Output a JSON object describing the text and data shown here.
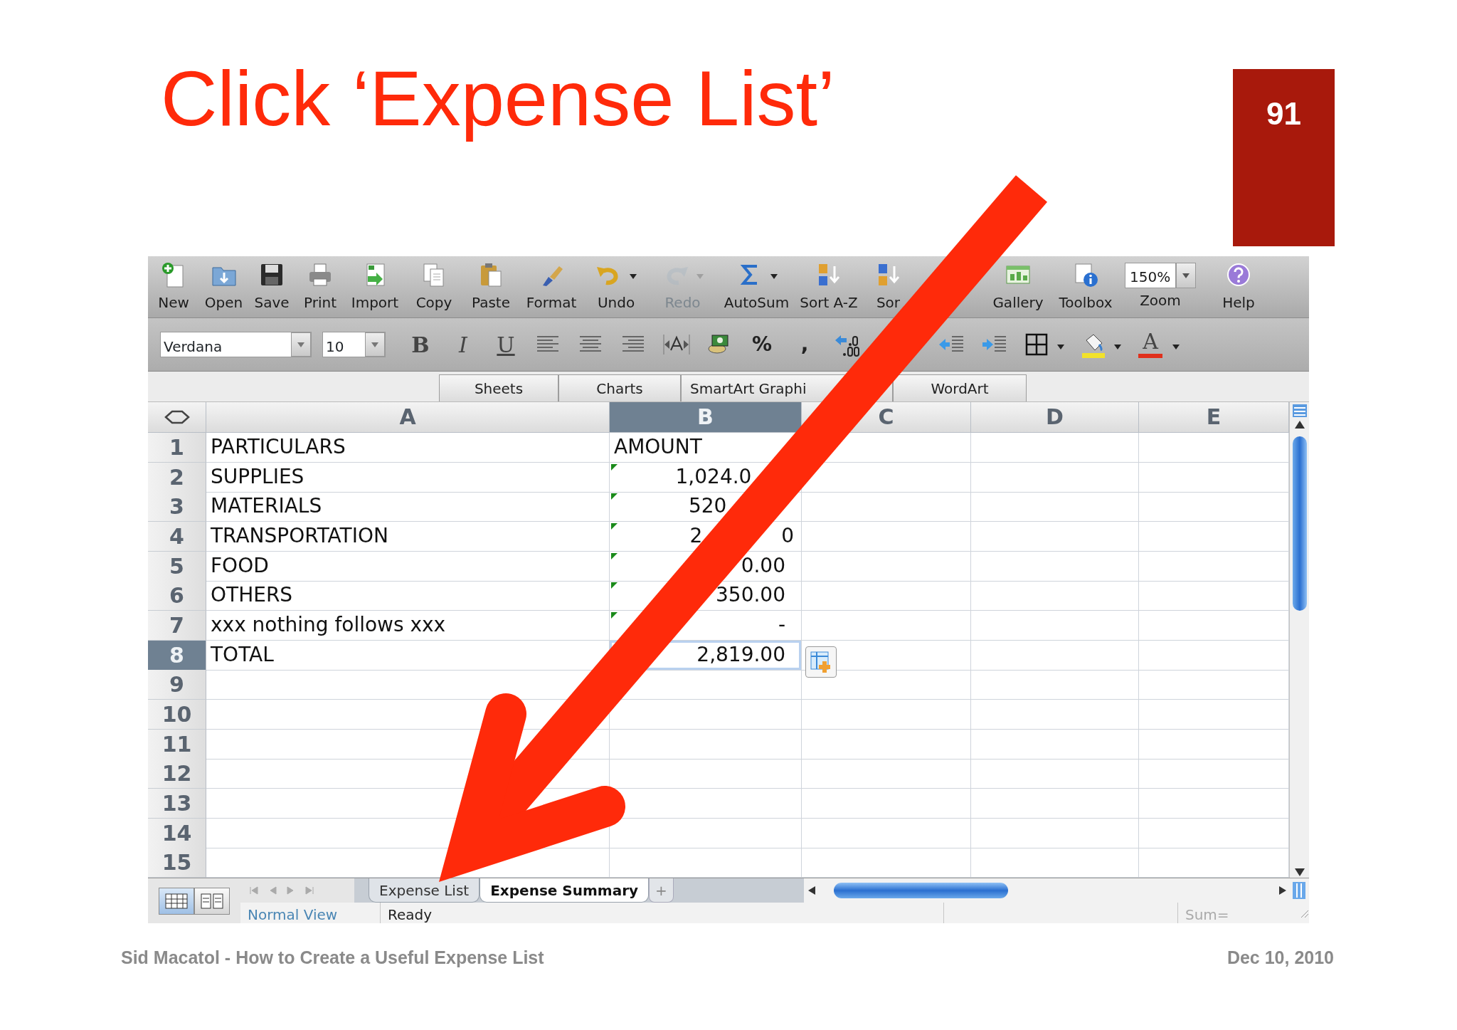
{
  "slide": {
    "title": "Click ‘Expense List’",
    "page_number": "91"
  },
  "standard_toolbar": [
    {
      "kind": "button",
      "label": "New",
      "disabled": false,
      "menu": false
    },
    {
      "kind": "button",
      "label": "Open",
      "disabled": false,
      "menu": false
    },
    {
      "kind": "button",
      "label": "Save",
      "disabled": false,
      "menu": false
    },
    {
      "kind": "button",
      "label": "Print",
      "disabled": false,
      "menu": false
    },
    {
      "kind": "button",
      "label": "Import",
      "disabled": false,
      "menu": false
    },
    {
      "kind": "button",
      "label": "Copy",
      "disabled": false,
      "menu": false
    },
    {
      "kind": "button",
      "label": "Paste",
      "disabled": false,
      "menu": false
    },
    {
      "kind": "button",
      "label": "Format",
      "disabled": false,
      "menu": false
    },
    {
      "kind": "button",
      "label": "Undo",
      "disabled": false,
      "menu": true
    },
    {
      "kind": "button",
      "label": "Redo",
      "disabled": true,
      "menu": true
    },
    {
      "kind": "button",
      "label": "AutoSum",
      "disabled": false,
      "menu": true
    },
    {
      "kind": "button",
      "label": "Sort A-Z",
      "disabled": false,
      "menu": false
    },
    {
      "kind": "button",
      "label": "Sor",
      "disabled": false,
      "menu": false
    },
    {
      "kind": "button",
      "label": "Gallery",
      "disabled": false,
      "menu": false
    },
    {
      "kind": "button",
      "label": "Toolbox",
      "disabled": false,
      "menu": false
    },
    {
      "kind": "combo",
      "label": "Zoom",
      "value": "150%",
      "disabled": false,
      "menu": true
    },
    {
      "kind": "button",
      "label": "Help",
      "disabled": false,
      "menu": false
    }
  ],
  "formatting_toolbar": {
    "font": "Verdana",
    "size": "10",
    "items": [
      {
        "kind": "text",
        "label": "B",
        "menu": false
      },
      {
        "kind": "text",
        "label": "I",
        "menu": false
      },
      {
        "kind": "text",
        "label": "U",
        "menu": false
      },
      {
        "kind": "icon",
        "menu": false
      },
      {
        "kind": "icon",
        "menu": false
      },
      {
        "kind": "icon",
        "menu": false
      },
      {
        "kind": "icon",
        "menu": false
      },
      {
        "kind": "icon",
        "menu": false
      },
      {
        "kind": "text",
        "label": "%",
        "menu": false
      },
      {
        "kind": "text",
        "label": ",",
        "menu": false
      },
      {
        "kind": "icon",
        "menu": false
      },
      {
        "kind": "icon",
        "menu": false
      },
      {
        "kind": "icon",
        "menu": false
      },
      {
        "kind": "icon",
        "menu": true
      },
      {
        "kind": "swatch",
        "color": "#f2e22a",
        "menu": true
      },
      {
        "kind": "swatch",
        "label": "A",
        "color": "#e0301c",
        "menu": true
      }
    ]
  },
  "ribbon_tabs": [
    {
      "label": "Sheets"
    },
    {
      "label": "Charts"
    },
    {
      "label": "SmartArt Graphi"
    },
    {
      "label": "WordArt"
    }
  ],
  "sheet": {
    "columns": [
      {
        "label": "A",
        "selected": false
      },
      {
        "label": "B",
        "selected": true
      },
      {
        "label": "C",
        "selected": false
      },
      {
        "label": "D",
        "selected": false
      },
      {
        "label": "E",
        "selected": false
      }
    ],
    "rows": [
      {
        "number": "1",
        "selected": false,
        "cells": [
          {
            "kind": "text",
            "text": "PARTICULARS"
          },
          {
            "kind": "text",
            "text": "AMOUNT",
            "flag": false
          }
        ]
      },
      {
        "number": "2",
        "selected": false,
        "cells": [
          {
            "kind": "text",
            "text": "SUPPLIES"
          },
          {
            "kind": "number",
            "fragments": [
              "1,024.0"
            ],
            "flag": true
          }
        ]
      },
      {
        "number": "3",
        "selected": false,
        "cells": [
          {
            "kind": "text",
            "text": "MATERIALS"
          },
          {
            "kind": "number",
            "fragments": [
              "520"
            ],
            "flag": true
          }
        ]
      },
      {
        "number": "4",
        "selected": false,
        "cells": [
          {
            "kind": "text",
            "text": "TRANSPORTATION"
          },
          {
            "kind": "number",
            "fragments": [
              "2",
              "0"
            ],
            "flag": true
          }
        ]
      },
      {
        "number": "5",
        "selected": false,
        "cells": [
          {
            "kind": "text",
            "text": "FOOD"
          },
          {
            "kind": "number",
            "fragments": [
              "0.00"
            ],
            "flag": true
          }
        ]
      },
      {
        "number": "6",
        "selected": false,
        "cells": [
          {
            "kind": "text",
            "text": "OTHERS"
          },
          {
            "kind": "number",
            "fragments": [
              "350.00"
            ],
            "flag": true
          }
        ]
      },
      {
        "number": "7",
        "selected": false,
        "cells": [
          {
            "kind": "text",
            "text": "xxx nothing follows xxx"
          },
          {
            "kind": "number",
            "fragments": [
              "-"
            ],
            "flag": true
          }
        ]
      },
      {
        "number": "8",
        "selected": true,
        "cells": [
          {
            "kind": "text",
            "text": "TOTAL"
          },
          {
            "kind": "number",
            "fragments": [
              "2,819.00"
            ],
            "flag": false
          }
        ]
      },
      {
        "number": "9",
        "selected": false,
        "cells": []
      },
      {
        "number": "10",
        "selected": false,
        "cells": []
      },
      {
        "number": "11",
        "selected": false,
        "cells": []
      },
      {
        "number": "12",
        "selected": false,
        "cells": []
      },
      {
        "number": "13",
        "selected": false,
        "cells": []
      },
      {
        "number": "14",
        "selected": false,
        "cells": []
      },
      {
        "number": "15",
        "selected": false,
        "cells": []
      }
    ]
  },
  "bottom_bar": {
    "views": [
      {
        "selected": true
      },
      {
        "selected": false
      }
    ],
    "sheet_tabs": [
      {
        "label": "Expense List",
        "selected": false
      },
      {
        "label": "Expense Summary",
        "selected": true
      }
    ],
    "add_tab": "+"
  },
  "status_bar": {
    "view": "Normal View",
    "state": "Ready",
    "sum": "Sum="
  },
  "footer": {
    "left": "Sid Macatol - How to Create a Useful Expense List",
    "right": "Dec 10, 2010"
  }
}
